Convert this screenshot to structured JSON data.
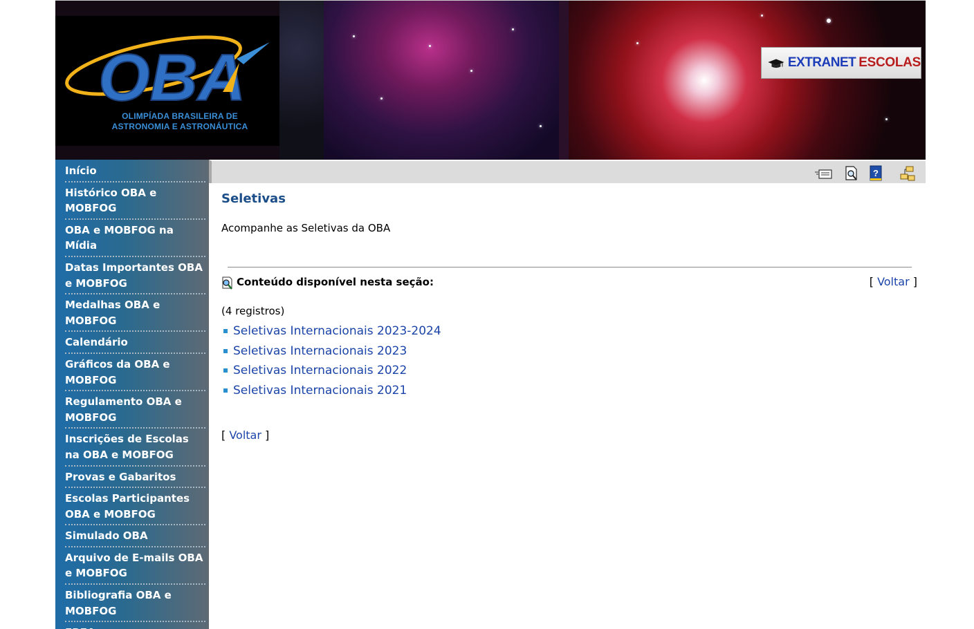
{
  "header": {
    "logo_text": "OBA",
    "logo_subtitle_line1": "OLIMPÍADA BRASILEIRA DE",
    "logo_subtitle_line2": "ASTRONOMIA E ASTRONÁUTICA",
    "extranet_part1": "EXTRANET",
    "extranet_part2": "ESCOLAS"
  },
  "sidebar": {
    "items": [
      {
        "label": "Início"
      },
      {
        "label": "Histórico OBA e MOBFOG"
      },
      {
        "label": "OBA e MOBFOG na Mídia"
      },
      {
        "label": "Datas Importantes OBA e MOBFOG"
      },
      {
        "label": "Medalhas OBA e MOBFOG"
      },
      {
        "label": "Calendário"
      },
      {
        "label": "Gráficos da OBA e MOBFOG"
      },
      {
        "label": "Regulamento OBA e MOBFOG"
      },
      {
        "label": "Inscrições de Escolas na OBA e MOBFOG"
      },
      {
        "label": "Provas e Gabaritos"
      },
      {
        "label": "Escolas Participantes OBA e MOBFOG"
      },
      {
        "label": "Simulado OBA"
      },
      {
        "label": "Arquivo de E-mails OBA e MOBFOG"
      },
      {
        "label": "Bibliografia OBA e MOBFOG"
      },
      {
        "label": "EREA"
      }
    ]
  },
  "toolbar": {
    "icons": [
      "send-email-icon",
      "print-preview-icon",
      "help-icon",
      "site-map-icon"
    ]
  },
  "main": {
    "title": "Seletivas",
    "intro": "Acompanhe as Seletivas da OBA",
    "section_label": "Conteúdo disponível nesta seção:",
    "back_label": "Voltar",
    "bracket_open": "[",
    "bracket_close": "]",
    "record_count": "(4 registros)",
    "records": [
      {
        "label": "Seletivas Internacionais 2023-2024"
      },
      {
        "label": "Seletivas Internacionais 2023"
      },
      {
        "label": "Seletivas Internacionais 2022"
      },
      {
        "label": "Seletivas Internacionais 2021"
      }
    ]
  },
  "colors": {
    "title": "#1b4d89",
    "link": "#1b44a8",
    "sidebar_start": "#1f6ca8",
    "sidebar_end": "#5e6a74",
    "toolbar": "#dcdcdc",
    "extranet_blue": "#1c3cb8",
    "extranet_red": "#b81c1c"
  }
}
